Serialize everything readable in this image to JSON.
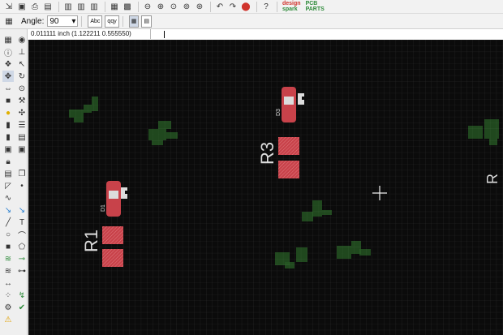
{
  "toolbar": {
    "icons": [
      "open-icon",
      "save-icon",
      "print-icon",
      "export-icon",
      "layers-icon",
      "layers-alt-icon",
      "layers-alt2-icon",
      "board-icon",
      "grid-icon",
      "zoom-out-icon",
      "zoom-in-icon",
      "zoom-area-icon",
      "zoom-fit-icon",
      "zoom-selection-icon",
      "undo-icon",
      "redo-icon",
      "stop-icon",
      "help-icon"
    ],
    "logo_line1": "design",
    "logo_line2": "spark",
    "pcb_label": "PCB",
    "pcb_sub": "PARTS"
  },
  "toolbar2": {
    "angle_label": "Angle:",
    "angle_value": "90",
    "mode_abc": "Abc",
    "mode_vert": "qqy"
  },
  "status": {
    "coordinates": "0.011111 inch (1.122211 0.555550)"
  },
  "canvas": {
    "background": "#0b0b0b",
    "labels": {
      "r1": "R1",
      "r3": "R3",
      "d1": "D1",
      "d3": "D3"
    },
    "pad_color": "#c8424a",
    "trace_color": "#2f8a2a",
    "silk_color": "#dcdcdc"
  }
}
